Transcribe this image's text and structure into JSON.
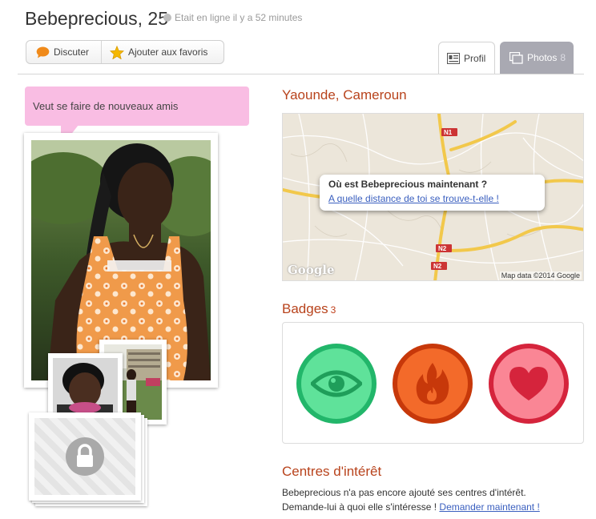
{
  "header": {
    "name": "Bebeprecious, 25",
    "online_status": "Etait en ligne il y a 52 minutes"
  },
  "actions": {
    "chat_label": "Discuter",
    "favorite_label": "Ajouter aux favoris"
  },
  "tabs": [
    {
      "label": "Profil",
      "active": true
    },
    {
      "label": "Photos",
      "count": "8",
      "active": false
    }
  ],
  "status_bubble": "Veut se faire de nouveaux amis",
  "location": {
    "title": "Yaounde, Cameroun",
    "popup_question": "Où est Bebeprecious maintenant ?",
    "popup_link": "A quelle distance de toi se trouve-t-elle !",
    "map_credit": "Map data ©2014 Google",
    "map_logo": "Google",
    "road_labels": [
      "N1",
      "N2",
      "N2"
    ]
  },
  "badges": {
    "title": "Badges",
    "count": "3",
    "items": [
      {
        "icon": "eye-icon",
        "color": "#22b66a"
      },
      {
        "icon": "fire-icon",
        "color": "#c7380a"
      },
      {
        "icon": "heart-icon",
        "color": "#d5243c"
      }
    ]
  },
  "interests": {
    "title": "Centres d'intérêt",
    "line1": "Bebeprecious n'a pas encore ajouté ses centres d'intérêt.",
    "line2_prefix": "Demande-lui à quoi elle s'intéresse ! ",
    "line2_link": "Demander maintenant !"
  },
  "colors": {
    "accent_title": "#b8431c",
    "bubble_pink": "#f9bde3",
    "link_blue": "#3a5fbf",
    "tab_inactive": "#a9a9b2"
  }
}
